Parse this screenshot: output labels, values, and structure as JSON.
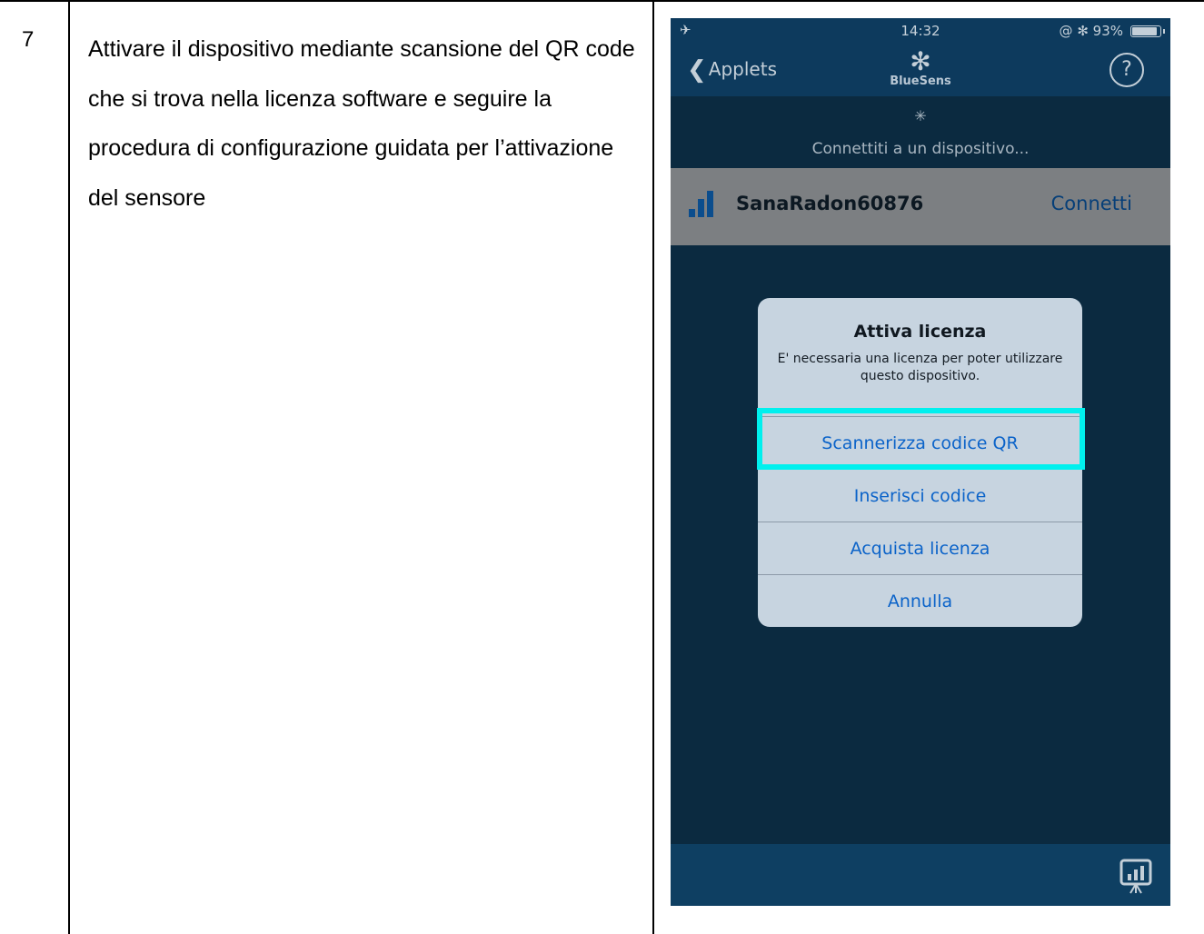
{
  "step": {
    "number": "7",
    "instruction": "Attivare il dispositivo mediante scansione del QR code che si trova nella licenza software e seguire la procedura di configurazione guidata per l’attivazione del sensore"
  },
  "phone": {
    "status_bar": {
      "left_icons": "airplane-icon, wifi-icon",
      "time": "14:32",
      "right_text": "@ ✻ 93%",
      "battery_percent": 93
    },
    "nav_bar": {
      "back_label": "Applets",
      "logo_text": "BlueSens",
      "help_label": "?"
    },
    "connecting_text": "Connettiti a un dispositivo...",
    "device": {
      "name": "SanaRadon60876",
      "action_label": "Connetti"
    },
    "alert": {
      "title": "Attiva licenza",
      "message": "E' necessaria una licenza per poter utilizzare questo dispositivo.",
      "buttons": [
        "Scannerizza codice QR",
        "Inserisci codice",
        "Acquista licenza",
        "Annulla"
      ],
      "highlighted_button": "Scannerizza codice QR"
    },
    "colors": {
      "nav": "#0d3a5d",
      "background": "#0b2a40",
      "highlight": "#00f0ee",
      "alert_button": "#0b63c9"
    }
  }
}
